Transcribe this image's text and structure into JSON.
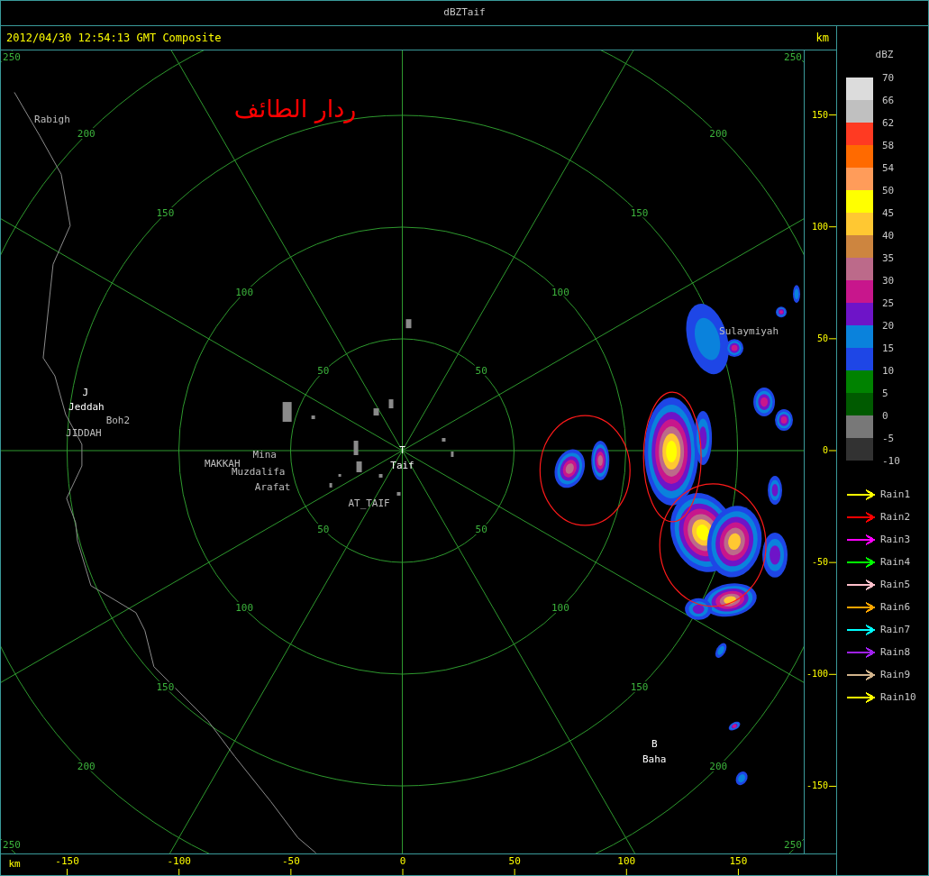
{
  "window": {
    "title": "dBZTaif"
  },
  "header": {
    "timestamp": "2012/04/30 12:54:13 GMT Composite",
    "unit": "km"
  },
  "map": {
    "title": "ردار الطائف",
    "rings": [
      {
        "labels": [
          "50",
          "50",
          "50",
          "50"
        ]
      },
      {
        "labels": [
          "100",
          "100",
          "100",
          "100"
        ]
      },
      {
        "labels": [
          "150",
          "150",
          "150",
          "150"
        ]
      },
      {
        "labels": [
          "200",
          "200",
          "200",
          "200"
        ]
      },
      {
        "labels": [
          "250",
          "250",
          "250",
          "250"
        ]
      }
    ],
    "places": [
      {
        "name": "Rabigh",
        "kind": "minor"
      },
      {
        "name": "J",
        "kind": "major"
      },
      {
        "name": "Jeddah",
        "kind": "major"
      },
      {
        "name": "Boh2",
        "kind": "minor"
      },
      {
        "name": "JIDDAH",
        "kind": "minor"
      },
      {
        "name": "MAKKAH",
        "kind": "minor"
      },
      {
        "name": "Mina",
        "kind": "minor"
      },
      {
        "name": "Muzdalifa",
        "kind": "minor"
      },
      {
        "name": "Arafat",
        "kind": "minor"
      },
      {
        "name": "AT_TAIF",
        "kind": "minor"
      },
      {
        "name": "T",
        "kind": "major"
      },
      {
        "name": "Taif",
        "kind": "major"
      },
      {
        "name": "Sulaymiyah",
        "kind": "minor"
      },
      {
        "name": "B",
        "kind": "major"
      },
      {
        "name": "Baha",
        "kind": "major"
      }
    ]
  },
  "y_axis": {
    "ticks": [
      "150",
      "100",
      "50",
      "0",
      "-50",
      "-100",
      "-150"
    ]
  },
  "x_axis": {
    "unit": "km",
    "ticks": [
      "-150",
      "-100",
      "-50",
      "0",
      "50",
      "100",
      "150"
    ]
  },
  "legend": {
    "title": "dBZ",
    "bins": [
      {
        "color": "#dcdcdc"
      },
      {
        "color": "#c0c0c0"
      },
      {
        "color": "#ff3a22"
      },
      {
        "color": "#ff6a00"
      },
      {
        "color": "#ff9c5a"
      },
      {
        "color": "#ffff00"
      },
      {
        "color": "#ffc832"
      },
      {
        "color": "#cd853f"
      },
      {
        "color": "#bc6a8a"
      },
      {
        "color": "#c8168c"
      },
      {
        "color": "#6e14c8"
      },
      {
        "color": "#0a82dc"
      },
      {
        "color": "#1e46e6"
      },
      {
        "color": "#008200"
      },
      {
        "color": "#005a00"
      },
      {
        "color": "#787878"
      },
      {
        "color": "#323232"
      }
    ],
    "labels": [
      "70",
      "66",
      "62",
      "58",
      "54",
      "50",
      "45",
      "40",
      "35",
      "30",
      "25",
      "20",
      "15",
      "10",
      "5",
      "0",
      "-5",
      "-10"
    ],
    "tracks": [
      {
        "label": "Rain1",
        "color": "#ffff00"
      },
      {
        "label": "Rain2",
        "color": "#ff0000"
      },
      {
        "label": "Rain3",
        "color": "#ff00ff"
      },
      {
        "label": "Rain4",
        "color": "#00ff00"
      },
      {
        "label": "Rain5",
        "color": "#ffc0cb"
      },
      {
        "label": "Rain6",
        "color": "#ffa500"
      },
      {
        "label": "Rain7",
        "color": "#00ffff"
      },
      {
        "label": "Rain8",
        "color": "#a020f0"
      },
      {
        "label": "Rain9",
        "color": "#d2b48c"
      },
      {
        "label": "Rain10",
        "color": "#ffff00"
      }
    ]
  }
}
